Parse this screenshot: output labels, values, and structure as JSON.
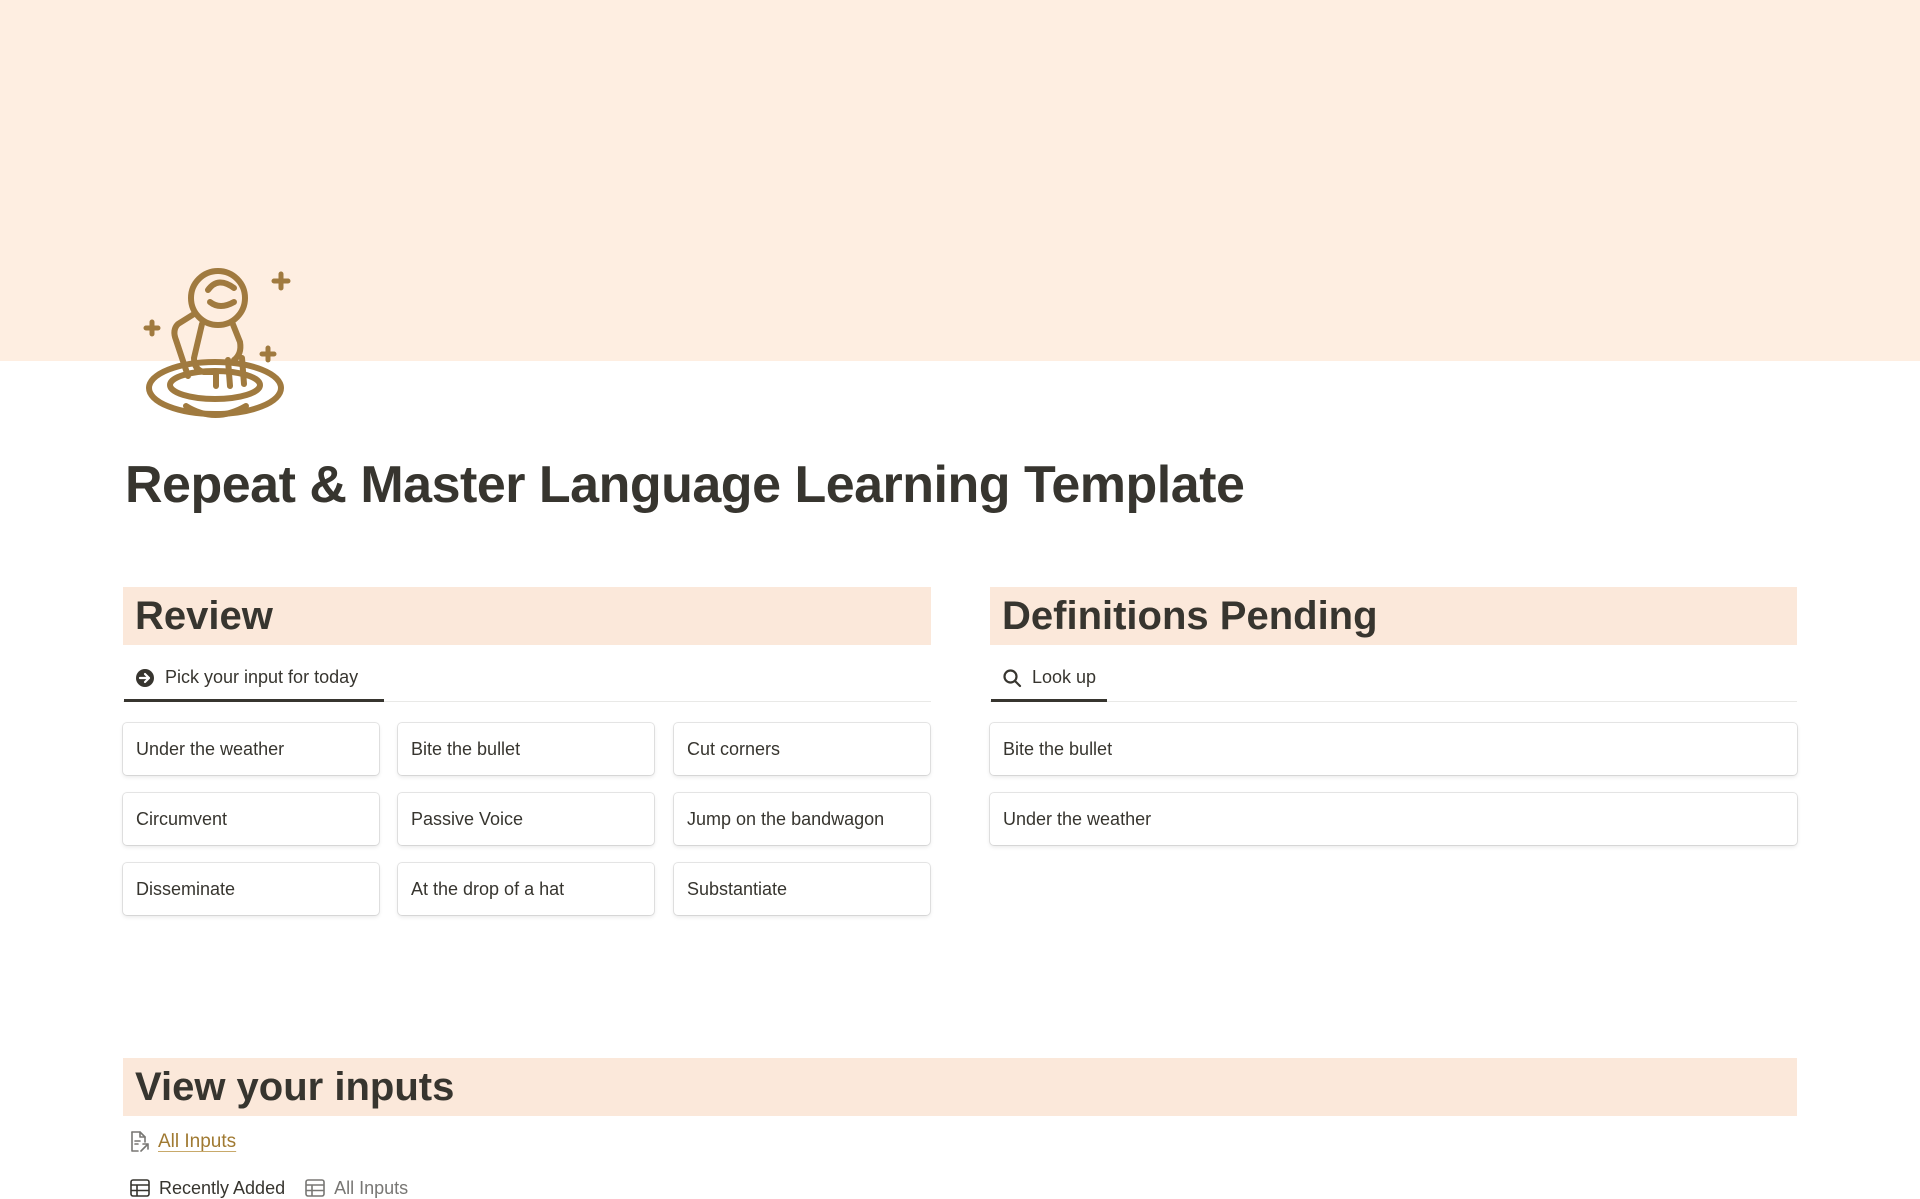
{
  "page": {
    "title": "Repeat & Master Language Learning Template",
    "cover_color": "#feeee1",
    "icon": "astronaut-icon",
    "icon_color": "#a07a3f"
  },
  "review": {
    "heading": "Review",
    "tab": {
      "label": "Pick your input for today",
      "icon": "arrow-circle-right-icon"
    },
    "cards": [
      "Under the weather",
      "Bite the bullet",
      "Cut corners",
      "Circumvent",
      "Passive Voice",
      "Jump on the bandwagon",
      "Disseminate",
      "At the drop of a hat",
      "Substantiate"
    ]
  },
  "definitions": {
    "heading": "Definitions Pending",
    "tab": {
      "label": "Look up",
      "icon": "search-icon"
    },
    "cards": [
      "Bite the bullet",
      "Under the weather"
    ]
  },
  "inputs": {
    "heading": "View your inputs",
    "link": {
      "label": "All Inputs",
      "icon": "page-link-icon",
      "color": "#a07a32"
    },
    "views": [
      {
        "label": "Recently Added",
        "icon": "table-icon",
        "active": true
      },
      {
        "label": "All Inputs",
        "icon": "table-icon",
        "active": false
      }
    ]
  },
  "colors": {
    "section_header_bg": "#fbe8da",
    "text": "#37352f",
    "muted_text": "#787774"
  }
}
